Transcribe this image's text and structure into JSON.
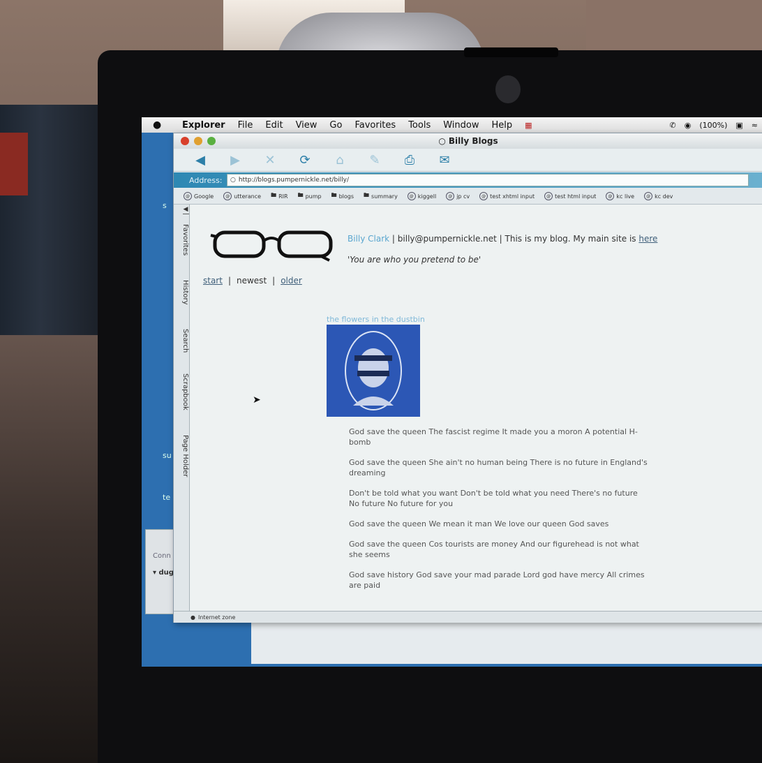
{
  "menubar": {
    "apple": "",
    "items": [
      "Explorer",
      "File",
      "Edit",
      "View",
      "Go",
      "Favorites",
      "Tools",
      "Window",
      "Help"
    ],
    "battery": "(100%)"
  },
  "window": {
    "title": "Billy Blogs"
  },
  "address": {
    "label": "Address:",
    "url": "http://blogs.pumpernickle.net/billy/"
  },
  "favorites": [
    {
      "label": "Google",
      "icon": "globe-icon"
    },
    {
      "label": "utterance",
      "icon": "globe-icon"
    },
    {
      "label": "RIR",
      "icon": "folder-icon"
    },
    {
      "label": "pump",
      "icon": "folder-icon"
    },
    {
      "label": "blogs",
      "icon": "folder-icon"
    },
    {
      "label": "summary",
      "icon": "folder-icon"
    },
    {
      "label": "kiggell",
      "icon": "globe-icon"
    },
    {
      "label": "jp cv",
      "icon": "globe-icon"
    },
    {
      "label": "test xhtml input",
      "icon": "globe-icon"
    },
    {
      "label": "test html input",
      "icon": "globe-icon"
    },
    {
      "label": "kc live",
      "icon": "globe-icon"
    },
    {
      "label": "kc dev",
      "icon": "globe-icon"
    }
  ],
  "sidebar_tabs": [
    "Favorites",
    "History",
    "Search",
    "Scrapbook",
    "Page Holder"
  ],
  "page": {
    "author": "Billy Clark",
    "sep1": " | ",
    "email": "billy@pumpernickle.net",
    "sep2": " | This is my blog. My main site is ",
    "here_link": "here",
    "tagline": "'You are who you pretend to be'",
    "nav": {
      "start": "start",
      "sep1": "|",
      "newest": "newest",
      "sep2": "|",
      "older": "older"
    },
    "post_title": "the flowers in the dustbin",
    "lyrics": [
      "God save the queen The fascist regime It made you a moron A potential H-bomb",
      "God save the queen She ain't no human being There is no future in England's dreaming",
      "Don't be told what you want Don't be told what you need There's no future No future No future for you",
      "God save the queen We mean it man We love our queen God saves",
      "God save the queen Cos tourists are money And our figurehead is not what she seems",
      "God save history God save your mad parade Lord god have mercy All crimes are paid"
    ]
  },
  "status": {
    "zone": "Internet zone"
  },
  "colors": {
    "accent": "#2e88b3",
    "link": "#3f5f7a",
    "author": "#5aa6cf"
  }
}
